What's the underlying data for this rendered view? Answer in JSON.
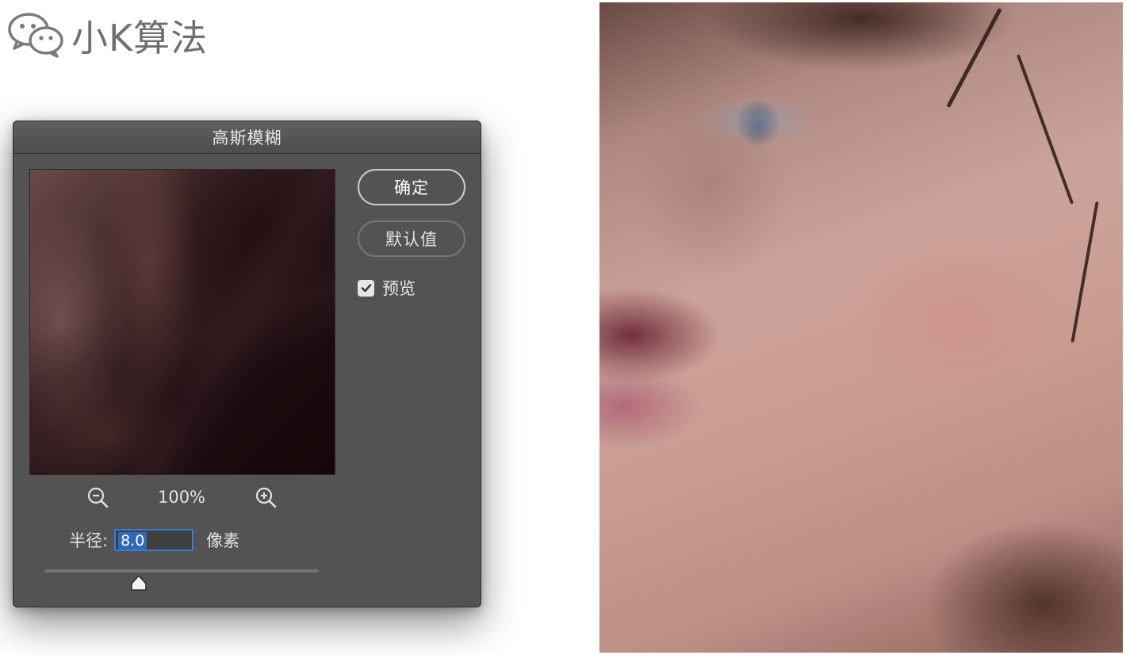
{
  "watermark": {
    "text": "小K算法",
    "icon": "wechat-icon"
  },
  "dialog": {
    "title": "高斯模糊",
    "ok_label": "确定",
    "default_label": "默认值",
    "preview_label": "预览",
    "preview_checked": true,
    "zoom_level": "100%",
    "radius_label": "半径:",
    "radius_value": "8.0",
    "radius_unit": "像素",
    "accent_color": "#3b7bd4"
  }
}
